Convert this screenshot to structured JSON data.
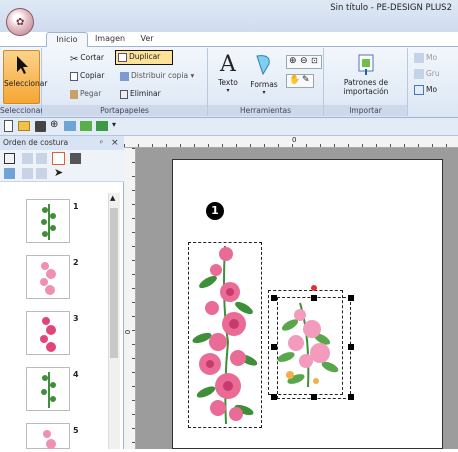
{
  "app": {
    "title": "Sin título - PE-DESIGN PLUS2"
  },
  "tabs": [
    {
      "label": "Inicio"
    },
    {
      "label": "Imagen"
    },
    {
      "label": "Ver"
    }
  ],
  "ribbon": {
    "select": {
      "label": "Seleccionar",
      "group": "Seleccionar"
    },
    "clipboard": {
      "cut": "Cortar",
      "copy": "Copiar",
      "paste": "Pegar",
      "duplicate": "Duplicar",
      "distribute": "Distribuir copia",
      "delete": "Eliminar",
      "group": "Portapapeles"
    },
    "tools": {
      "text": "Texto",
      "shapes": "Formas",
      "group": "Herramientas"
    },
    "import": {
      "label_line1": "Patrones de",
      "label_line2": "importación",
      "group": "Importar"
    },
    "partial": {
      "item1": "Mo",
      "item2": "Gru",
      "item3": "Mo"
    }
  },
  "panel": {
    "title": "Orden de costura",
    "pin": "ᵖ",
    "close": "×",
    "items": [
      {
        "num": "1"
      },
      {
        "num": "2"
      },
      {
        "num": "3"
      },
      {
        "num": "4"
      },
      {
        "num": "5"
      }
    ]
  },
  "ruler": {
    "zero_h": "0",
    "zero_v": "0"
  },
  "canvas": {
    "badge": "1"
  },
  "colors": {
    "accent": "#f6a632",
    "ribbon_bg": "#dbe6f4",
    "pink": "#e8588a",
    "leaf": "#3f8f3a"
  }
}
